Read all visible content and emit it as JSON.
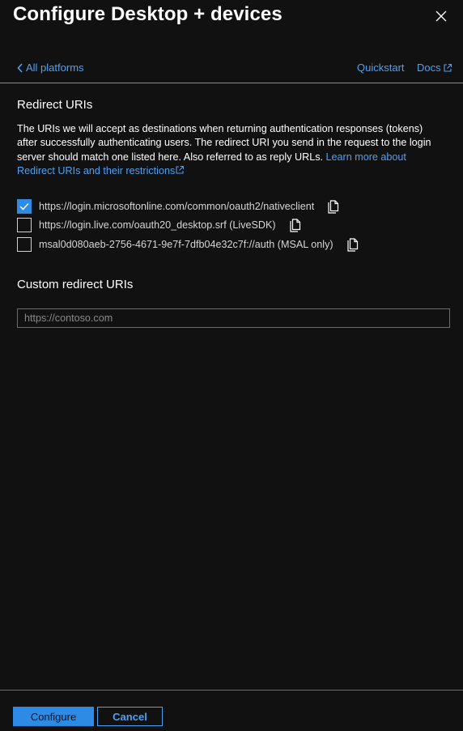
{
  "header": {
    "title": "Configure Desktop + devices"
  },
  "nav": {
    "back_label": "All platforms",
    "quickstart_label": "Quickstart",
    "docs_label": "Docs"
  },
  "redirect": {
    "heading": "Redirect URIs",
    "description": "The URIs we will accept as destinations when returning authentication responses (tokens) after successfully authenticating users. The redirect URI you send in the request to the login server should match one listed here. Also referred to as reply URLs.",
    "learn_more_label": "Learn more about Redirect URIs and their restrictions",
    "uris": [
      {
        "uri": "https://login.microsoftonline.com/common/oauth2/nativeclient",
        "checked": true
      },
      {
        "uri": "https://login.live.com/oauth20_desktop.srf (LiveSDK)",
        "checked": false
      },
      {
        "uri": "msal0d080aeb-2756-4671-9e7f-7dfb04e32c7f://auth (MSAL only)",
        "checked": false
      }
    ]
  },
  "custom": {
    "heading": "Custom redirect URIs",
    "value": "",
    "placeholder": "https://contoso.com"
  },
  "footer": {
    "configure_label": "Configure",
    "cancel_label": "Cancel"
  },
  "colors": {
    "background": "#111111",
    "accent": "#2d8be6",
    "link": "#4ea1f3"
  }
}
